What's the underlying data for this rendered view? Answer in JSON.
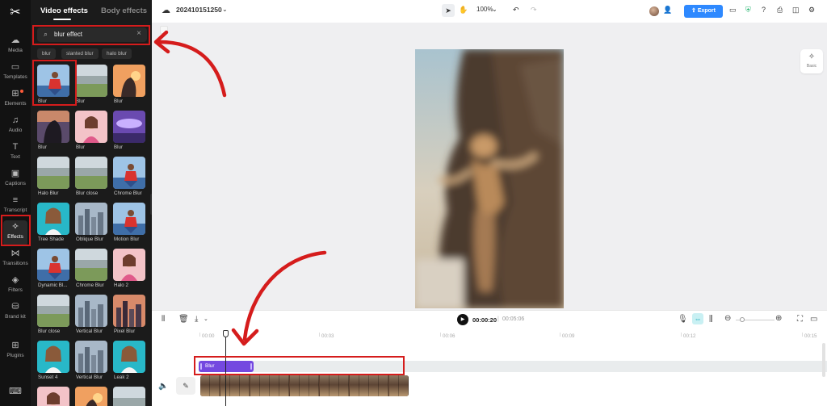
{
  "rail": {
    "items": [
      {
        "icon": "☁",
        "label": "Media",
        "name": "media"
      },
      {
        "icon": "▭",
        "label": "Templates",
        "name": "templates"
      },
      {
        "icon": "⊞",
        "label": "Elements",
        "name": "elements"
      },
      {
        "icon": "♫",
        "label": "Audio",
        "name": "audio"
      },
      {
        "icon": "T",
        "label": "Text",
        "name": "text"
      },
      {
        "icon": "▣",
        "label": "Captions",
        "name": "captions"
      },
      {
        "icon": "≡",
        "label": "Transcript",
        "name": "transcript"
      },
      {
        "icon": "✧",
        "label": "Effects",
        "name": "effects"
      },
      {
        "icon": "⋈",
        "label": "Transitions",
        "name": "transitions"
      },
      {
        "icon": "◈",
        "label": "Filters",
        "name": "filters"
      },
      {
        "icon": "⛁",
        "label": "Brand kit",
        "name": "brand-kit"
      },
      {
        "icon": "⊞",
        "label": "Plugins",
        "name": "plugins"
      },
      {
        "icon": "⌨",
        "label": "",
        "name": "keyboard"
      }
    ],
    "active": "effects"
  },
  "panel": {
    "tab_video": "Video effects",
    "tab_body": "Body effects",
    "search_value": "blur effect",
    "chips": [
      "blur",
      "slanted blur",
      "halo blur"
    ],
    "effects": [
      {
        "label": "Blur",
        "thumb": "man-red-shirt"
      },
      {
        "label": "Blur",
        "thumb": "field-landscape"
      },
      {
        "label": "Blur",
        "thumb": "sunset-silhouette"
      },
      {
        "label": "Blur",
        "thumb": "silhouette-dark"
      },
      {
        "label": "Blur",
        "thumb": "girl-pink"
      },
      {
        "label": "Blur",
        "thumb": "purple-sky"
      },
      {
        "label": "Halo Blur",
        "thumb": "field-landscape"
      },
      {
        "label": "Blur close",
        "thumb": "field-landscape"
      },
      {
        "label": "Chrome Blur",
        "thumb": "man-red-shirt"
      },
      {
        "label": "Tree Shade",
        "thumb": "girl-teal"
      },
      {
        "label": "Oblique Blur",
        "thumb": "city"
      },
      {
        "label": "Motion Blur",
        "thumb": "man-red-shirt"
      },
      {
        "label": "Dynamic Bl...",
        "thumb": "man-red-shirt"
      },
      {
        "label": "Chrome Blur",
        "thumb": "field-landscape"
      },
      {
        "label": "Halo 2",
        "thumb": "girl-pink"
      },
      {
        "label": "Blur close",
        "thumb": "field-landscape"
      },
      {
        "label": "Vertical Blur",
        "thumb": "city"
      },
      {
        "label": "Pixel Blur",
        "thumb": "city-dusk"
      },
      {
        "label": "Sunset 4",
        "thumb": "girl-teal"
      },
      {
        "label": "Vertical Blur",
        "thumb": "city"
      },
      {
        "label": "Leak 2",
        "thumb": "girl-teal"
      },
      {
        "label": "",
        "thumb": "girl-pink"
      },
      {
        "label": "",
        "thumb": "sunset-silhouette"
      },
      {
        "label": "",
        "thumb": "field-landscape"
      }
    ]
  },
  "topbar": {
    "project_name": "202410151250",
    "zoom": "100%",
    "export_label": "Export"
  },
  "canvas": {
    "basic_label": "Basic"
  },
  "timeline": {
    "current_time": "00:00:20",
    "separator": "|",
    "total_time": "00:05:06",
    "ruler": [
      "00:00",
      "00:03",
      "00:06",
      "00:09",
      "00:12",
      "00:15"
    ],
    "effect_clip_label": "Blur"
  },
  "colors": {
    "accent": "#2e89ff",
    "effect_clip": "#7448e0",
    "annotation": "#d51c1c",
    "panel_bg": "#1b1b1b"
  }
}
